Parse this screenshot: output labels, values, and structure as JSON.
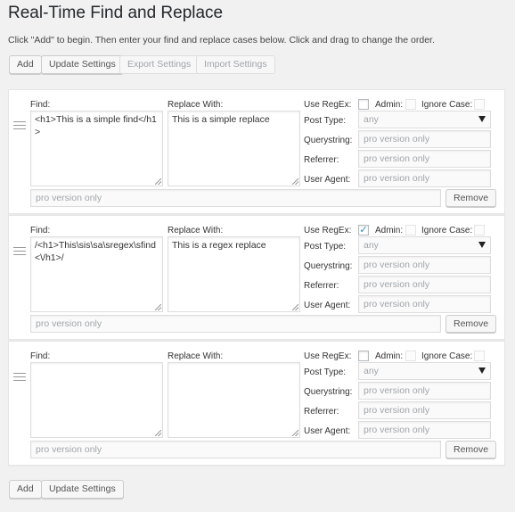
{
  "page": {
    "title": "Real-Time Find and Replace",
    "intro": "Click \"Add\" to begin. Then enter your find and replace cases below. Click and drag to change the order."
  },
  "toolbar_top": {
    "add": "Add",
    "update": "Update Settings",
    "export": "Export Settings",
    "import": "Import Settings"
  },
  "labels": {
    "find": "Find:",
    "replace_with": "Replace With:",
    "use_regex": "Use RegEx:",
    "admin": "Admin:",
    "ignore_case": "Ignore Case:",
    "post_type": "Post Type:",
    "querystring": "Querystring:",
    "referrer": "Referrer:",
    "user_agent": "User Agent:",
    "remove": "Remove"
  },
  "rules": [
    {
      "find": "<h1>This is a simple find</h1>",
      "replace": "This is a simple replace",
      "use_regex": false,
      "post_type": "any",
      "querystring": "pro version only",
      "referrer": "pro version only",
      "user_agent": "pro version only",
      "pro_field": "pro version only"
    },
    {
      "find": "/<h1>This\\sis\\sa\\sregex\\sfind<\\/h1>/",
      "replace": "This is a regex replace",
      "use_regex": true,
      "post_type": "any",
      "querystring": "pro version only",
      "referrer": "pro version only",
      "user_agent": "pro version only",
      "pro_field": "pro version only"
    },
    {
      "find": "",
      "replace": "",
      "use_regex": false,
      "post_type": "any",
      "querystring": "pro version only",
      "referrer": "pro version only",
      "user_agent": "pro version only",
      "pro_field": "pro version only"
    }
  ],
  "toolbar_bottom": {
    "add": "Add",
    "update": "Update Settings"
  }
}
